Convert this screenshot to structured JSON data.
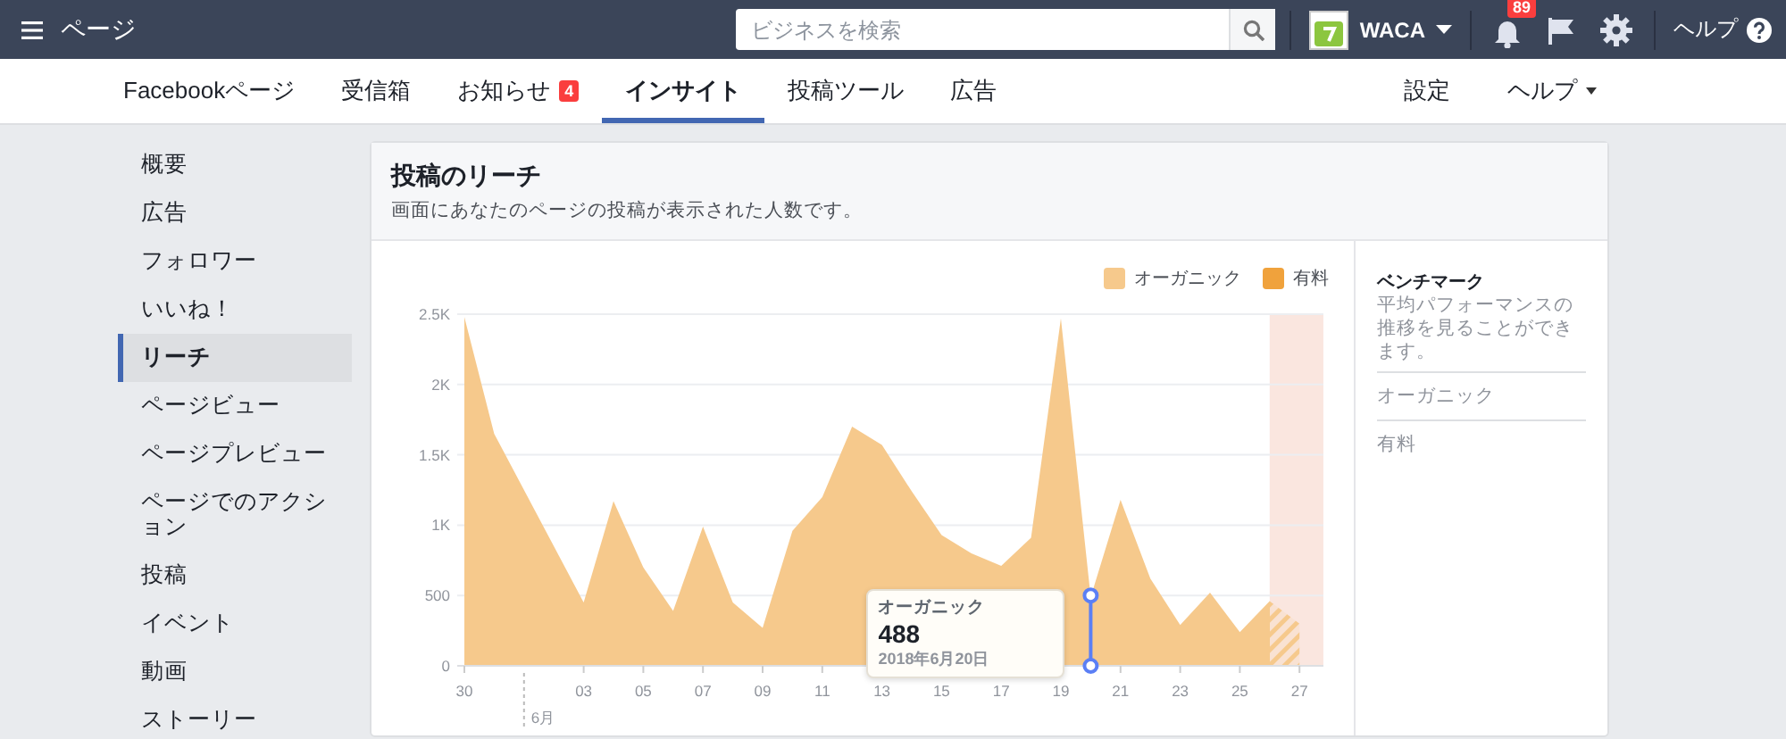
{
  "top_bar": {
    "title": "ページ",
    "search": {
      "placeholder": "ビジネスを検索"
    },
    "account": {
      "name": "WACA"
    },
    "notifications": {
      "count": "89"
    },
    "help": {
      "label": "ヘルプ"
    }
  },
  "tabs": [
    {
      "label": "Facebookページ",
      "selected": false
    },
    {
      "label": "受信箱",
      "selected": false
    },
    {
      "label": "お知らせ",
      "selected": false,
      "badge": "4"
    },
    {
      "label": "インサイト",
      "selected": true
    },
    {
      "label": "投稿ツール",
      "selected": false
    },
    {
      "label": "広告",
      "selected": false
    }
  ],
  "right_tabs": [
    {
      "label": "設定",
      "dropdown": false
    },
    {
      "label": "ヘルプ",
      "dropdown": true
    }
  ],
  "sidebar": {
    "items": [
      {
        "label": "概要",
        "selected": false
      },
      {
        "label": "広告",
        "selected": false
      },
      {
        "label": "フォロワー",
        "selected": false
      },
      {
        "label": "いいね！",
        "selected": false
      },
      {
        "label": "リーチ",
        "selected": true
      },
      {
        "label": "ページビュー",
        "selected": false
      },
      {
        "label": "ページプレビュー",
        "selected": false
      },
      {
        "label": "ページでのアクション",
        "selected": false
      },
      {
        "label": "投稿",
        "selected": false
      },
      {
        "label": "イベント",
        "selected": false
      },
      {
        "label": "動画",
        "selected": false
      },
      {
        "label": "ストーリー",
        "selected": false
      }
    ]
  },
  "card": {
    "title": "投稿のリーチ",
    "subtitle": "画面にあなたのページの投稿が表示された人数です。",
    "chart_data": {
      "type": "area",
      "categories": [
        "30",
        null,
        null,
        null,
        "03",
        null,
        "05",
        null,
        "07",
        null,
        "09",
        null,
        "11",
        null,
        "13",
        null,
        "15",
        null,
        "17",
        null,
        "19",
        null,
        "21",
        null,
        "23",
        null,
        "25",
        null,
        "27"
      ],
      "series": [
        {
          "name": "オーガニック",
          "color": "#f6c98c",
          "values": [
            2480,
            1650,
            1250,
            850,
            450,
            1170,
            700,
            390,
            990,
            450,
            270,
            960,
            1200,
            1700,
            1570,
            1240,
            930,
            800,
            710,
            910,
            2470,
            488,
            1180,
            620,
            290,
            520,
            240,
            460,
            300
          ]
        },
        {
          "name": "有料",
          "color": "#f0a23c",
          "values": [
            null,
            null,
            null,
            null,
            null,
            null,
            null,
            null,
            null,
            null,
            null,
            null,
            null,
            null,
            null,
            null,
            null,
            null,
            null,
            null,
            null,
            null,
            null,
            null,
            null,
            null,
            null,
            null,
            null
          ]
        }
      ],
      "grid": true,
      "ylim": [
        0,
        2500
      ],
      "yticks": [
        {
          "value": 0,
          "label": "0"
        },
        {
          "value": 500,
          "label": "500"
        },
        {
          "value": 1000,
          "label": "1K"
        },
        {
          "value": 1500,
          "label": "1.5K"
        },
        {
          "value": 2000,
          "label": "2K"
        },
        {
          "value": 2500,
          "label": "2.5K"
        }
      ]
    },
    "month_label": "6月",
    "tooltip": {
      "series": "オーガニック",
      "value": "488",
      "date": "2018年6月20日"
    },
    "benchmark": {
      "title": "ベンチマーク",
      "description": "平均パフォーマンスの推移を見ることができます。",
      "items": [
        "オーガニック",
        "有料"
      ]
    }
  }
}
